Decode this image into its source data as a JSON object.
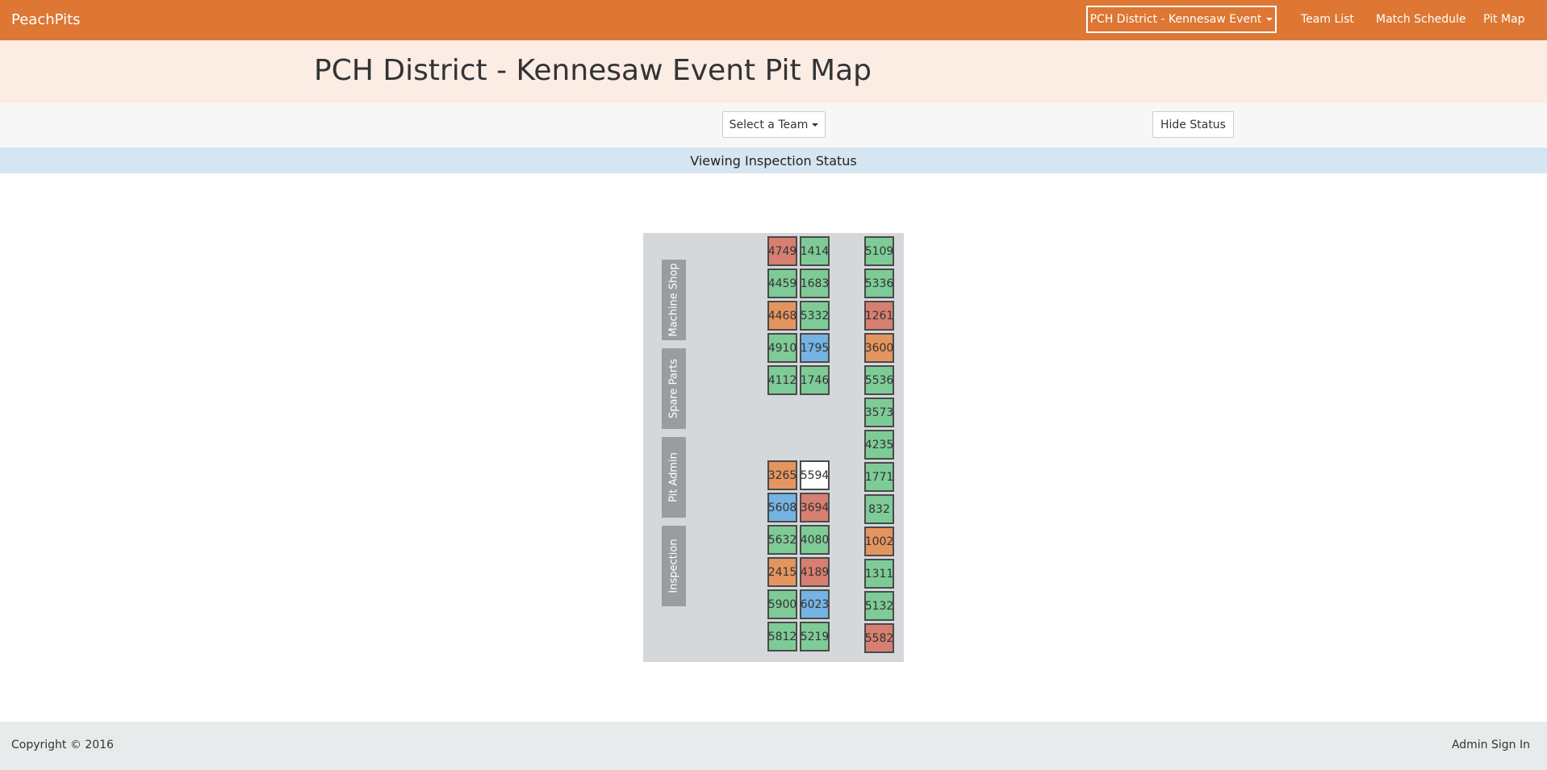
{
  "navbar": {
    "brand": "PeachPits",
    "event_selector": "PCH District - Kennesaw Event",
    "links": [
      "Team List",
      "Match Schedule",
      "Pit Map"
    ]
  },
  "page": {
    "title": "PCH District - Kennesaw Event Pit Map"
  },
  "controls": {
    "select_team": "Select a Team",
    "hide_status": "Hide Status"
  },
  "status_banner": "Viewing Inspection Status",
  "zones": [
    "Machine Shop",
    "Spare Parts",
    "Pit Admin",
    "Inspection"
  ],
  "status_colors": {
    "green": "#7ecb97",
    "red": "#d77f71",
    "orange": "#e4955f",
    "blue": "#74b3e2",
    "white": "#ffffff"
  },
  "pits": {
    "left_column_a_top": [
      {
        "team": "4749",
        "status": "red"
      },
      {
        "team": "4459",
        "status": "green"
      },
      {
        "team": "4468",
        "status": "orange"
      },
      {
        "team": "4910",
        "status": "green"
      },
      {
        "team": "4112",
        "status": "green"
      }
    ],
    "left_column_b_top": [
      {
        "team": "1414",
        "status": "green"
      },
      {
        "team": "1683",
        "status": "green"
      },
      {
        "team": "5332",
        "status": "green"
      },
      {
        "team": "1795",
        "status": "blue"
      },
      {
        "team": "1746",
        "status": "green"
      }
    ],
    "left_column_a_bottom": [
      {
        "team": "3265",
        "status": "orange"
      },
      {
        "team": "5608",
        "status": "blue"
      },
      {
        "team": "5632",
        "status": "green"
      },
      {
        "team": "2415",
        "status": "orange"
      },
      {
        "team": "5900",
        "status": "green"
      },
      {
        "team": "5812",
        "status": "green"
      }
    ],
    "left_column_b_bottom": [
      {
        "team": "5594",
        "status": "white"
      },
      {
        "team": "3694",
        "status": "red"
      },
      {
        "team": "4080",
        "status": "green"
      },
      {
        "team": "4189",
        "status": "red"
      },
      {
        "team": "6023",
        "status": "blue"
      },
      {
        "team": "5219",
        "status": "green"
      }
    ],
    "right_column": [
      {
        "team": "5109",
        "status": "green"
      },
      {
        "team": "5336",
        "status": "green"
      },
      {
        "team": "1261",
        "status": "red"
      },
      {
        "team": "3600",
        "status": "orange"
      },
      {
        "team": "5536",
        "status": "green"
      },
      {
        "team": "3573",
        "status": "green"
      },
      {
        "team": "4235",
        "status": "green"
      },
      {
        "team": "1771",
        "status": "green"
      },
      {
        "team": "832",
        "status": "green"
      },
      {
        "team": "1002",
        "status": "orange"
      },
      {
        "team": "1311",
        "status": "green"
      },
      {
        "team": "5132",
        "status": "green"
      },
      {
        "team": "5582",
        "status": "red"
      }
    ]
  },
  "footer": {
    "copyright": "Copyright © 2016",
    "admin_link": "Admin Sign In"
  }
}
